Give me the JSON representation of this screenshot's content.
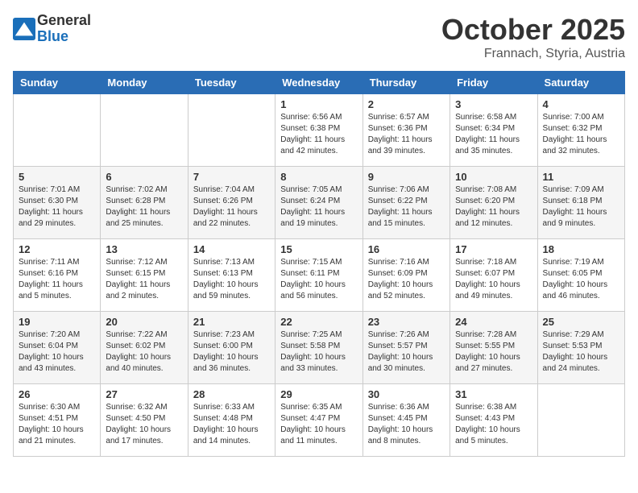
{
  "header": {
    "logo_general": "General",
    "logo_blue": "Blue",
    "month": "October 2025",
    "location": "Frannach, Styria, Austria"
  },
  "weekdays": [
    "Sunday",
    "Monday",
    "Tuesday",
    "Wednesday",
    "Thursday",
    "Friday",
    "Saturday"
  ],
  "weeks": [
    [
      {
        "day": "",
        "sunrise": "",
        "sunset": "",
        "daylight": ""
      },
      {
        "day": "",
        "sunrise": "",
        "sunset": "",
        "daylight": ""
      },
      {
        "day": "",
        "sunrise": "",
        "sunset": "",
        "daylight": ""
      },
      {
        "day": "1",
        "sunrise": "Sunrise: 6:56 AM",
        "sunset": "Sunset: 6:38 PM",
        "daylight": "Daylight: 11 hours and 42 minutes."
      },
      {
        "day": "2",
        "sunrise": "Sunrise: 6:57 AM",
        "sunset": "Sunset: 6:36 PM",
        "daylight": "Daylight: 11 hours and 39 minutes."
      },
      {
        "day": "3",
        "sunrise": "Sunrise: 6:58 AM",
        "sunset": "Sunset: 6:34 PM",
        "daylight": "Daylight: 11 hours and 35 minutes."
      },
      {
        "day": "4",
        "sunrise": "Sunrise: 7:00 AM",
        "sunset": "Sunset: 6:32 PM",
        "daylight": "Daylight: 11 hours and 32 minutes."
      }
    ],
    [
      {
        "day": "5",
        "sunrise": "Sunrise: 7:01 AM",
        "sunset": "Sunset: 6:30 PM",
        "daylight": "Daylight: 11 hours and 29 minutes."
      },
      {
        "day": "6",
        "sunrise": "Sunrise: 7:02 AM",
        "sunset": "Sunset: 6:28 PM",
        "daylight": "Daylight: 11 hours and 25 minutes."
      },
      {
        "day": "7",
        "sunrise": "Sunrise: 7:04 AM",
        "sunset": "Sunset: 6:26 PM",
        "daylight": "Daylight: 11 hours and 22 minutes."
      },
      {
        "day": "8",
        "sunrise": "Sunrise: 7:05 AM",
        "sunset": "Sunset: 6:24 PM",
        "daylight": "Daylight: 11 hours and 19 minutes."
      },
      {
        "day": "9",
        "sunrise": "Sunrise: 7:06 AM",
        "sunset": "Sunset: 6:22 PM",
        "daylight": "Daylight: 11 hours and 15 minutes."
      },
      {
        "day": "10",
        "sunrise": "Sunrise: 7:08 AM",
        "sunset": "Sunset: 6:20 PM",
        "daylight": "Daylight: 11 hours and 12 minutes."
      },
      {
        "day": "11",
        "sunrise": "Sunrise: 7:09 AM",
        "sunset": "Sunset: 6:18 PM",
        "daylight": "Daylight: 11 hours and 9 minutes."
      }
    ],
    [
      {
        "day": "12",
        "sunrise": "Sunrise: 7:11 AM",
        "sunset": "Sunset: 6:16 PM",
        "daylight": "Daylight: 11 hours and 5 minutes."
      },
      {
        "day": "13",
        "sunrise": "Sunrise: 7:12 AM",
        "sunset": "Sunset: 6:15 PM",
        "daylight": "Daylight: 11 hours and 2 minutes."
      },
      {
        "day": "14",
        "sunrise": "Sunrise: 7:13 AM",
        "sunset": "Sunset: 6:13 PM",
        "daylight": "Daylight: 10 hours and 59 minutes."
      },
      {
        "day": "15",
        "sunrise": "Sunrise: 7:15 AM",
        "sunset": "Sunset: 6:11 PM",
        "daylight": "Daylight: 10 hours and 56 minutes."
      },
      {
        "day": "16",
        "sunrise": "Sunrise: 7:16 AM",
        "sunset": "Sunset: 6:09 PM",
        "daylight": "Daylight: 10 hours and 52 minutes."
      },
      {
        "day": "17",
        "sunrise": "Sunrise: 7:18 AM",
        "sunset": "Sunset: 6:07 PM",
        "daylight": "Daylight: 10 hours and 49 minutes."
      },
      {
        "day": "18",
        "sunrise": "Sunrise: 7:19 AM",
        "sunset": "Sunset: 6:05 PM",
        "daylight": "Daylight: 10 hours and 46 minutes."
      }
    ],
    [
      {
        "day": "19",
        "sunrise": "Sunrise: 7:20 AM",
        "sunset": "Sunset: 6:04 PM",
        "daylight": "Daylight: 10 hours and 43 minutes."
      },
      {
        "day": "20",
        "sunrise": "Sunrise: 7:22 AM",
        "sunset": "Sunset: 6:02 PM",
        "daylight": "Daylight: 10 hours and 40 minutes."
      },
      {
        "day": "21",
        "sunrise": "Sunrise: 7:23 AM",
        "sunset": "Sunset: 6:00 PM",
        "daylight": "Daylight: 10 hours and 36 minutes."
      },
      {
        "day": "22",
        "sunrise": "Sunrise: 7:25 AM",
        "sunset": "Sunset: 5:58 PM",
        "daylight": "Daylight: 10 hours and 33 minutes."
      },
      {
        "day": "23",
        "sunrise": "Sunrise: 7:26 AM",
        "sunset": "Sunset: 5:57 PM",
        "daylight": "Daylight: 10 hours and 30 minutes."
      },
      {
        "day": "24",
        "sunrise": "Sunrise: 7:28 AM",
        "sunset": "Sunset: 5:55 PM",
        "daylight": "Daylight: 10 hours and 27 minutes."
      },
      {
        "day": "25",
        "sunrise": "Sunrise: 7:29 AM",
        "sunset": "Sunset: 5:53 PM",
        "daylight": "Daylight: 10 hours and 24 minutes."
      }
    ],
    [
      {
        "day": "26",
        "sunrise": "Sunrise: 6:30 AM",
        "sunset": "Sunset: 4:51 PM",
        "daylight": "Daylight: 10 hours and 21 minutes."
      },
      {
        "day": "27",
        "sunrise": "Sunrise: 6:32 AM",
        "sunset": "Sunset: 4:50 PM",
        "daylight": "Daylight: 10 hours and 17 minutes."
      },
      {
        "day": "28",
        "sunrise": "Sunrise: 6:33 AM",
        "sunset": "Sunset: 4:48 PM",
        "daylight": "Daylight: 10 hours and 14 minutes."
      },
      {
        "day": "29",
        "sunrise": "Sunrise: 6:35 AM",
        "sunset": "Sunset: 4:47 PM",
        "daylight": "Daylight: 10 hours and 11 minutes."
      },
      {
        "day": "30",
        "sunrise": "Sunrise: 6:36 AM",
        "sunset": "Sunset: 4:45 PM",
        "daylight": "Daylight: 10 hours and 8 minutes."
      },
      {
        "day": "31",
        "sunrise": "Sunrise: 6:38 AM",
        "sunset": "Sunset: 4:43 PM",
        "daylight": "Daylight: 10 hours and 5 minutes."
      },
      {
        "day": "",
        "sunrise": "",
        "sunset": "",
        "daylight": ""
      }
    ]
  ]
}
